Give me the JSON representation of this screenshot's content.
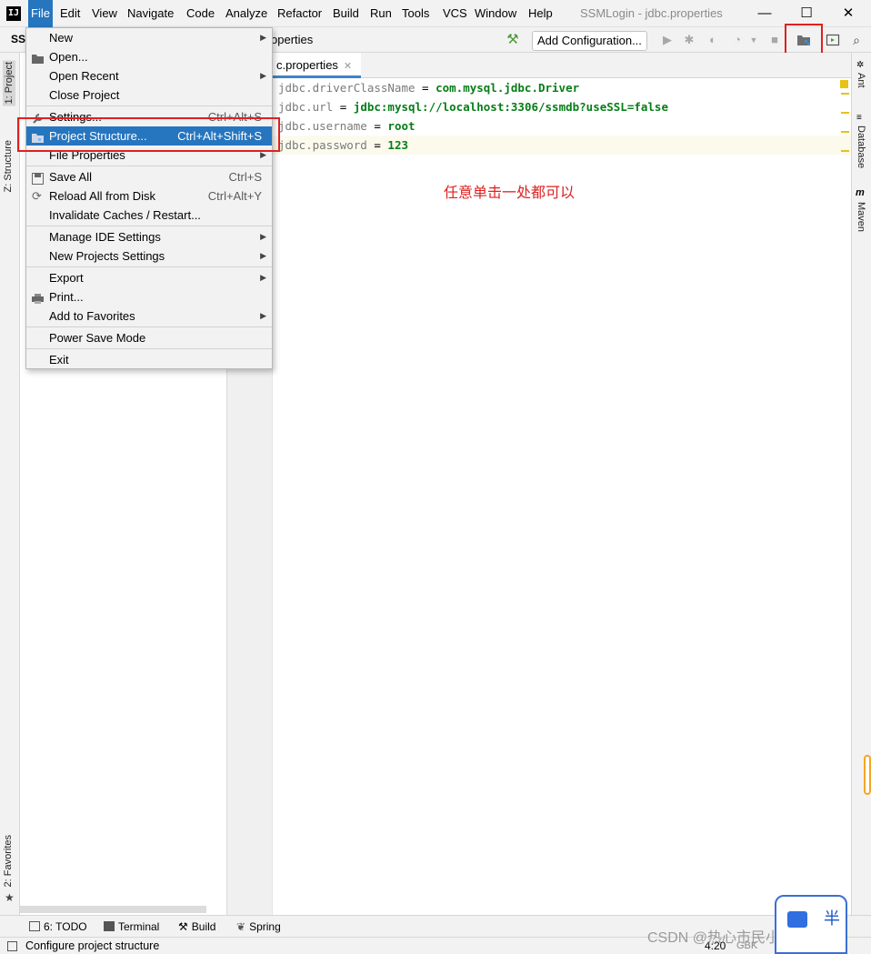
{
  "window": {
    "title": "SSMLogin - jdbc.properties",
    "logo": "IJ",
    "minimize_icon": "—",
    "maximize_icon": "☐",
    "close_icon": "✕"
  },
  "menubar": {
    "items": [
      "File",
      "Edit",
      "View",
      "Navigate",
      "Code",
      "Analyze",
      "Refactor",
      "Build",
      "Run",
      "Tools",
      "VCS",
      "Window",
      "Help"
    ]
  },
  "navbar": {
    "project": "SSI",
    "breadcrumb": "operties",
    "add_configuration": "Add Configuration..."
  },
  "file_menu": {
    "items": [
      {
        "label": "New",
        "shortcut": "",
        "submenu": true
      },
      {
        "label": "Open...",
        "shortcut": "",
        "submenu": false
      },
      {
        "label": "Open Recent",
        "shortcut": "",
        "submenu": true
      },
      {
        "label": "Close Project",
        "shortcut": "",
        "submenu": false
      },
      {
        "label": "Settings...",
        "shortcut": "Ctrl+Alt+S",
        "submenu": false
      },
      {
        "label": "Project Structure...",
        "shortcut": "Ctrl+Alt+Shift+S",
        "submenu": false,
        "selected": true
      },
      {
        "label": "File Properties",
        "shortcut": "",
        "submenu": true
      },
      {
        "label": "Save All",
        "shortcut": "Ctrl+S",
        "submenu": false
      },
      {
        "label": "Reload All from Disk",
        "shortcut": "Ctrl+Alt+Y",
        "submenu": false
      },
      {
        "label": "Invalidate Caches / Restart...",
        "shortcut": "",
        "submenu": false
      },
      {
        "label": "Manage IDE Settings",
        "shortcut": "",
        "submenu": true
      },
      {
        "label": "New Projects Settings",
        "shortcut": "",
        "submenu": true
      },
      {
        "label": "Export",
        "shortcut": "",
        "submenu": true
      },
      {
        "label": "Print...",
        "shortcut": "",
        "submenu": false
      },
      {
        "label": "Add to Favorites",
        "shortcut": "",
        "submenu": true
      },
      {
        "label": "Power Save Mode",
        "shortcut": "",
        "submenu": false
      },
      {
        "label": "Exit",
        "shortcut": "",
        "submenu": false
      }
    ]
  },
  "left_tool_tabs": {
    "project": "1: Project",
    "structure": "Z: Structure",
    "favorites": "2: Favorites"
  },
  "right_tool_tabs": {
    "ant": "Ant",
    "database": "Database",
    "maven": "Maven"
  },
  "editor": {
    "tab_label": "c.properties",
    "tab_close": "✕",
    "lines": [
      {
        "key": "jdbc.driverClassName",
        "sep": " = ",
        "value": "com.mysql.jdbc.Driver"
      },
      {
        "key": "jdbc.url",
        "sep": " = ",
        "value": "jdbc:mysql://localhost:3306/ssmdb?useSSL=false"
      },
      {
        "key": "jdbc.username",
        "sep": " = ",
        "value": "root"
      },
      {
        "key": "jdbc.password",
        "sep": " = ",
        "value": "123"
      }
    ],
    "annotation": "任意单击一处都可以"
  },
  "bottom_tools": {
    "todo": "6: TODO",
    "terminal": "Terminal",
    "build": "Build",
    "spring": "Spring"
  },
  "status": {
    "message": "Configure project structure",
    "position": "4:20",
    "encoding": "GBK"
  },
  "watermark": {
    "text": "CSDN @热心市民小黄同学",
    "mascot_text": "半"
  },
  "colors": {
    "menu_highlight": "#2675bf",
    "callout_red": "#e02020",
    "value_green": "#067d17",
    "current_line": "#fcfaed"
  }
}
